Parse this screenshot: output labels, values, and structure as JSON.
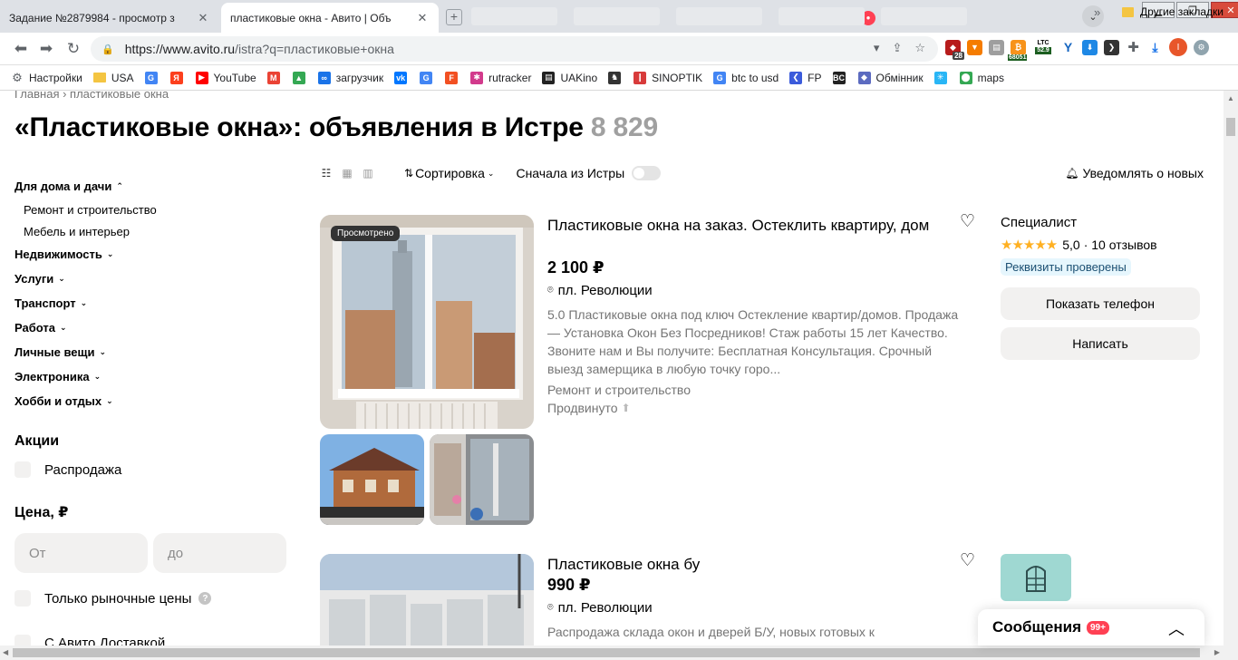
{
  "browser": {
    "tabs": [
      {
        "title": "Задание №2879984 - просмотр з",
        "favicon": "SP"
      },
      {
        "title": "пластиковые окна - Авито | Объ",
        "favicon": "●"
      }
    ],
    "faded_tabs": [
      "",
      "",
      "",
      "",
      "",
      ""
    ],
    "url_host": "https://www.avito.ru",
    "url_rest": "/istra?q=пластиковые+окна",
    "ext_badges": {
      "shield": "28",
      "coin1": "68051",
      "ltc_label": "LTC",
      "ltc_value": "52.9"
    },
    "profile_initial": "I",
    "bookmarks": [
      {
        "label": "Настройки",
        "icon": "gear-icon",
        "color": "#5f6368"
      },
      {
        "label": "USA",
        "icon": "folder-icon",
        "color": "#f4c542"
      },
      {
        "label": "",
        "icon": "google-icon",
        "color": "#4285f4"
      },
      {
        "label": "",
        "icon": "yandex-icon",
        "color": "#fc3f1d"
      },
      {
        "label": "YouTube",
        "icon": "youtube-icon",
        "color": "#ff0000"
      },
      {
        "label": "",
        "icon": "gmail-icon",
        "color": "#ea4335"
      },
      {
        "label": "",
        "icon": "drive-icon",
        "color": "#34a853"
      },
      {
        "label": "загрузчик",
        "icon": "loader-icon",
        "color": "#1a73e8"
      },
      {
        "label": "",
        "icon": "vk-icon",
        "color": "#0077ff"
      },
      {
        "label": "",
        "icon": "translate-icon",
        "color": "#4285f4"
      },
      {
        "label": "",
        "icon": "f-icon",
        "color": "#f25022"
      },
      {
        "label": "rutracker",
        "icon": "rutracker-icon",
        "color": "#d23a8c"
      },
      {
        "label": "UAKino",
        "icon": "uakino-icon",
        "color": "#222222"
      },
      {
        "label": "",
        "icon": "chess-icon",
        "color": "#333333"
      },
      {
        "label": "SINOPTIK",
        "icon": "thermometer-icon",
        "color": "#d83b3b"
      },
      {
        "label": "btc to usd",
        "icon": "google-icon",
        "color": "#4285f4"
      },
      {
        "label": "FP",
        "icon": "fp-icon",
        "color": "#3b5bdb"
      },
      {
        "label": "",
        "icon": "bc-icon",
        "color": "#222222"
      },
      {
        "label": "Обмінник",
        "icon": "exchange-icon",
        "color": "#5c6bc0"
      },
      {
        "label": "",
        "icon": "snowflake-icon",
        "color": "#29b6f6"
      },
      {
        "label": "maps",
        "icon": "maps-icon",
        "color": "#34a853"
      }
    ],
    "more": "»",
    "other_bookmarks": "Другие закладки"
  },
  "page": {
    "breadcrumb": "Главная › пластиковые окна",
    "title_main": "«Пластиковые окна»: объявления в Истре",
    "title_count": "8 829"
  },
  "sidebar": {
    "category_main": "Для дома и дачи",
    "subcategories": [
      "Ремонт и строительство",
      "Мебель и интерьер"
    ],
    "categories": [
      "Недвижимость",
      "Услуги",
      "Транспорт",
      "Работа",
      "Личные вещи",
      "Электроника",
      "Хобби и отдых"
    ],
    "promo_title": "Акции",
    "sale_label": "Распродажа",
    "price_title": "Цена, ₽",
    "price_from_placeholder": "От",
    "price_to_placeholder": "до",
    "market_only_label": "Только рыночные цены",
    "delivery_label": "С Авито Доставкой"
  },
  "toolbar": {
    "sort_label": "Сортировка",
    "local_first_label": "Сначала из Истры",
    "notify_label": "Уведомлять о новых"
  },
  "listings": [
    {
      "seen_badge": "Просмотрено",
      "title": "Пластиковые окна на заказ. Остеклить квартиру, дом",
      "price": "2 100 ₽",
      "location": "пл. Революции",
      "description": "5.0 Пластиковые окна под ключ Остекление квартир/домов. Продажа — Установка Окон Без Посредников! Стаж работы 15 лет Качество. Звоните нам и Вы получите: Бесплатная Консультация. Срочный выезд замерщика в любую точку горо...",
      "category": "Ремонт и строительство",
      "promoted": "Продвинуто",
      "seller_type": "Специалист",
      "rating_value": "5,0",
      "reviews": "· 10 отзывов",
      "verified": "Реквизиты проверены",
      "show_phone": "Показать телефон",
      "write": "Написать"
    },
    {
      "title": "Пластиковые окна бу",
      "price": "990 ₽",
      "location": "пл. Революции",
      "description": "Распродажа склада окон и дверей Б/У, новых готовых к"
    }
  ],
  "messages": {
    "label": "Сообщения",
    "count": "99+"
  }
}
